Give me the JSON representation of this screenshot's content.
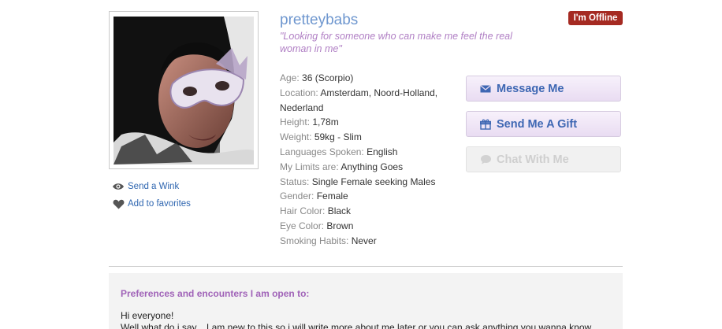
{
  "profile": {
    "username": "pretteybabs",
    "tagline": "\"Looking for someone who can make me feel the real woman in me\"",
    "status_badge": "I'm Offline",
    "photo_icon": "profile-photo"
  },
  "side_links": {
    "wink_label": "Send a Wink",
    "wink_icon": "eye-icon",
    "favorites_label": "Add to favorites",
    "favorites_icon": "heart-icon"
  },
  "details": [
    {
      "label": "Age:",
      "value": "36 (Scorpio)"
    },
    {
      "label": "Location:",
      "value": "Amsterdam, Noord-Holland, Nederland"
    },
    {
      "label": "Height:",
      "value": "1,78m"
    },
    {
      "label": "Weight:",
      "value": "59kg - Slim"
    },
    {
      "label": "Languages Spoken:",
      "value": "English"
    },
    {
      "label": "My Limits are:",
      "value": "Anything Goes"
    },
    {
      "label": "Status:",
      "value": "Single Female seeking Males"
    },
    {
      "label": "Gender:",
      "value": "Female"
    },
    {
      "label": "Hair Color:",
      "value": "Black"
    },
    {
      "label": "Eye Color:",
      "value": "Brown"
    },
    {
      "label": "Smoking Habits:",
      "value": "Never"
    }
  ],
  "actions": {
    "message_label": "Message Me",
    "message_icon": "envelope-icon",
    "gift_label": "Send Me A Gift",
    "gift_icon": "gift-icon",
    "chat_label": "Chat With Me",
    "chat_icon": "chat-bubble-icon"
  },
  "preferences": {
    "title": "Preferences and encounters I am open to:",
    "line1": "Hi everyone!",
    "line2": "Well what do i say... I am new to this so i will write more about me later or you can ask anything you wanna know"
  },
  "colors": {
    "username": "#6f97cf",
    "tagline": "#b07fc4",
    "offline_badge": "#a52a22",
    "button_text": "#3e67b3",
    "pref_title": "#a063b8"
  }
}
